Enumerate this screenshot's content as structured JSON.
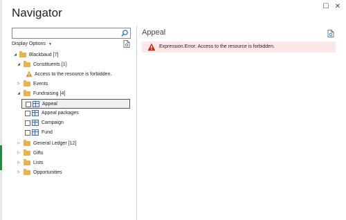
{
  "window": {
    "title": "Navigator",
    "maximize_glyph": "☐",
    "close_glyph": "✕"
  },
  "left_pane": {
    "search": {
      "value": "",
      "placeholder": ""
    },
    "display_options": {
      "label": "Display Options",
      "caret": "▼"
    },
    "tree": {
      "root": {
        "label": "Blackbaud [7]",
        "expanded": true
      },
      "constituents": {
        "label": "Constituents [1]",
        "expanded": true
      },
      "constituents_error": {
        "label": "Access to the resource is forbidden."
      },
      "events": {
        "label": "Events",
        "expanded": false
      },
      "fundraising": {
        "label": "Fundraising [4]",
        "expanded": true
      },
      "appeal": {
        "label": "Appeal",
        "checked": false,
        "selected": true
      },
      "appeal_packages": {
        "label": "Appeal packages",
        "checked": false
      },
      "campaign": {
        "label": "Campaign",
        "checked": false
      },
      "fund": {
        "label": "Fund",
        "checked": false
      },
      "general_ledger": {
        "label": "General Ledger [12]",
        "expanded": false
      },
      "gifts": {
        "label": "Gifts",
        "expanded": false
      },
      "lists": {
        "label": "Lists",
        "expanded": false
      },
      "opportunities": {
        "label": "Opportunities",
        "expanded": false
      }
    }
  },
  "right_pane": {
    "title": "Appeal",
    "error_message": "Expression.Error: Access to the resource is forbidden."
  },
  "colors": {
    "folder": "#e8b44a",
    "error_background": "#fde7e9",
    "error_icon": "#c42b1c",
    "warning_icon": "#d69e2e",
    "accent_blue": "#0f6cbd",
    "taskbar_green": "#1e8e3e"
  },
  "icons": {
    "expanded": "◢",
    "collapsed": "▷"
  }
}
